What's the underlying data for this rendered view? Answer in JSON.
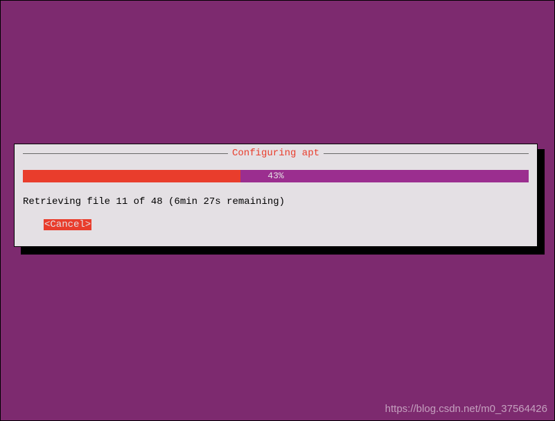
{
  "dialog": {
    "title": "Configuring apt",
    "progress_percent_label": "43%",
    "progress_value": 43,
    "status_text": "Retrieving file 11 of 48 (6min 27s remaining)",
    "cancel_label": "<Cancel>"
  },
  "watermark": "https://blog.csdn.net/m0_37564426",
  "colors": {
    "background": "#7d2a6f",
    "dialog_bg": "#e4e0e4",
    "accent_red": "#e93d2c",
    "progress_bg": "#9b2e8f"
  },
  "chart_data": {
    "type": "bar",
    "title": "Configuring apt",
    "categories": [
      "progress"
    ],
    "values": [
      43
    ],
    "ylim": [
      0,
      100
    ],
    "xlabel": "",
    "ylabel": "percent"
  }
}
